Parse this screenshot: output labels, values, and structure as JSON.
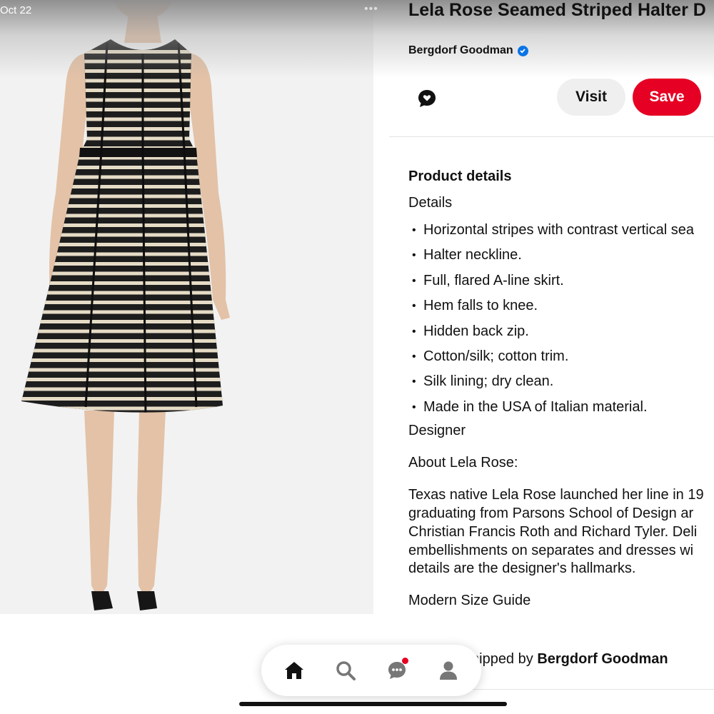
{
  "status": {
    "date": "Oct 22"
  },
  "pin": {
    "title": "Lela Rose Seamed Striped Halter D",
    "brand": "Bergdorf Goodman",
    "visit_label": "Visit",
    "save_label": "Save",
    "more_icon": "•••"
  },
  "colors": {
    "save": "#e60023",
    "verified": "#0a74e6",
    "visit_bg": "#efefef"
  },
  "icons": [
    "more-icon",
    "verified-badge-icon",
    "comment-icon",
    "home-icon",
    "search-icon",
    "messages-icon",
    "profile-icon"
  ],
  "details": {
    "heading": "Product details",
    "subheading": "Details",
    "bullets": [
      "Horizontal stripes with contrast vertical sea",
      "Halter neckline.",
      "Full, flared A-line skirt.",
      "Hem falls to knee.",
      "Hidden back zip.",
      "Cotton/silk; cotton trim.",
      "Silk lining; dry clean.",
      "Made in the USA of Italian material."
    ],
    "designer_label": "Designer",
    "about_label": "About Lela Rose:",
    "bio_lines": [
      "Texas native Lela Rose launched her line in 19",
      "graduating from Parsons School of Design ar",
      "Christian Francis Roth and Richard Tyler. Deli",
      "embellishments on separates and dresses wi",
      "details are the designer's hallmarks."
    ],
    "size_guide": "Modern Size Guide"
  },
  "shipping": {
    "prefix": "hipped by",
    "seller": "Bergdorf Goodman"
  }
}
